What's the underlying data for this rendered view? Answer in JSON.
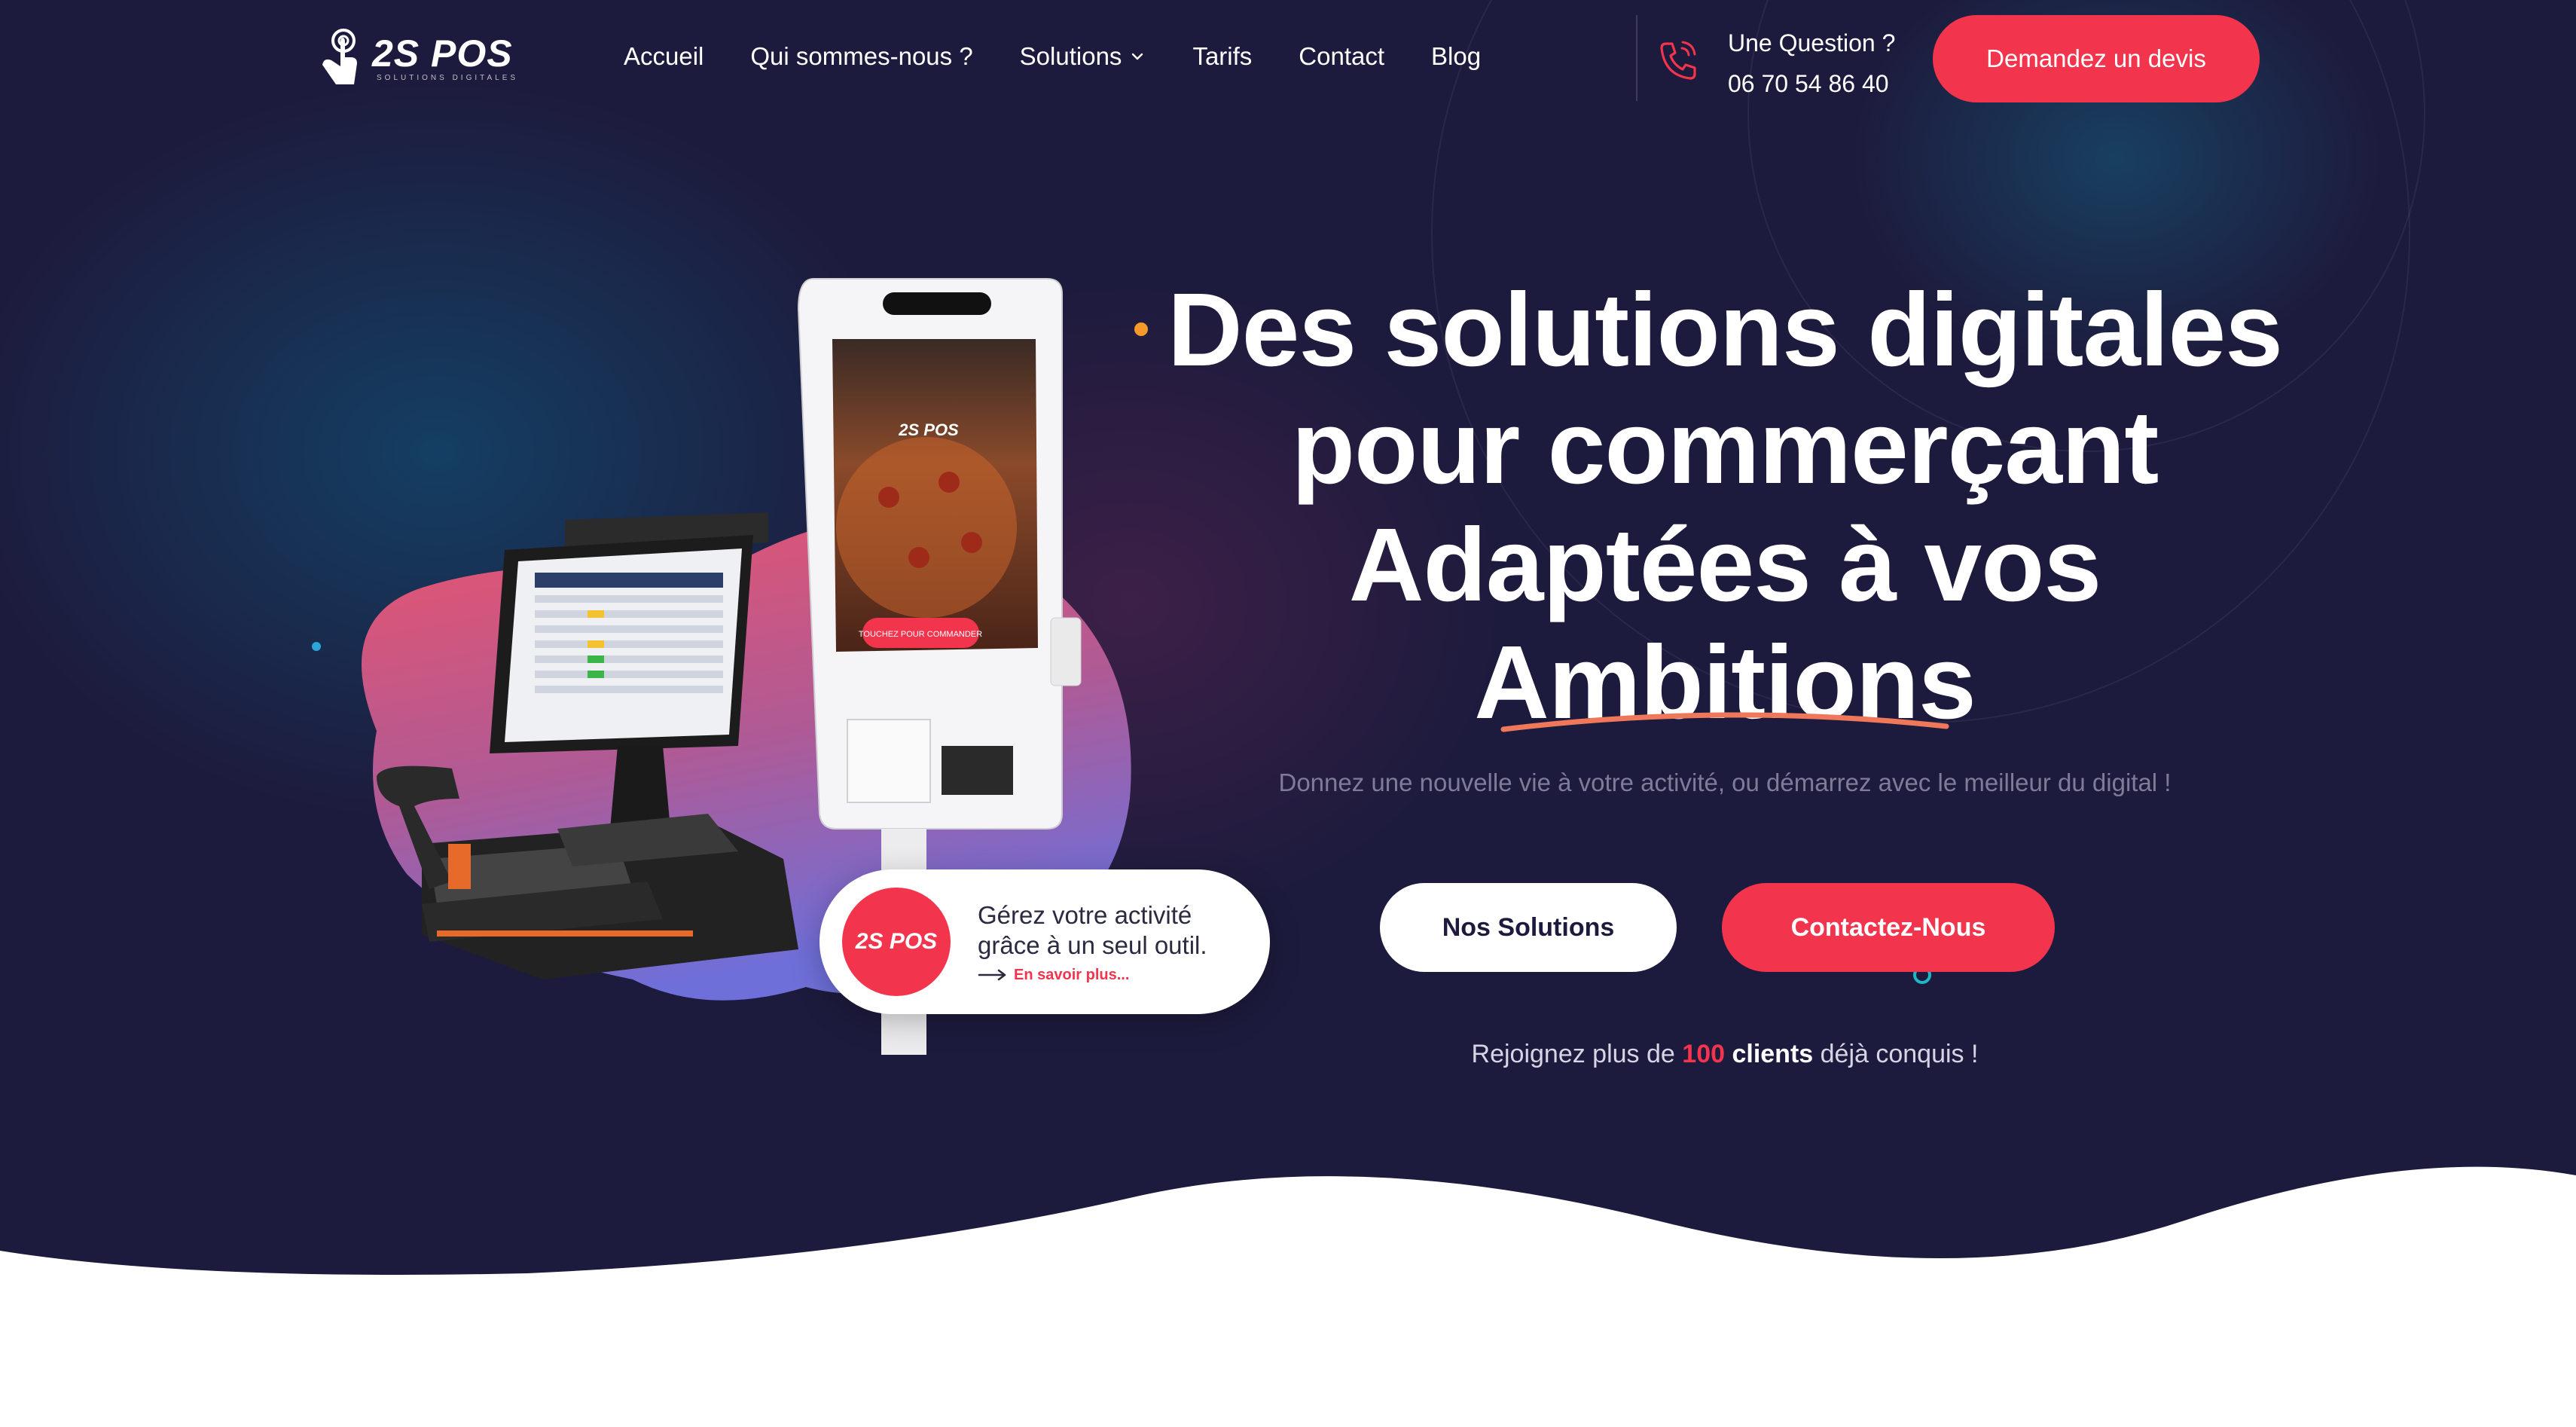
{
  "brand": {
    "name": "2S POS",
    "tagline": "SOLUTIONS DIGITALES",
    "accent_color": "#f2344d",
    "background_color": "#1d1b3d"
  },
  "nav": {
    "items": [
      {
        "label": "Accueil"
      },
      {
        "label": "Qui sommes-nous ?"
      },
      {
        "label": "Solutions",
        "has_dropdown": true
      },
      {
        "label": "Tarifs"
      },
      {
        "label": "Contact"
      },
      {
        "label": "Blog"
      }
    ]
  },
  "contact": {
    "question_label": "Une Question ?",
    "phone": "06 70 54 86 40",
    "icon": "phone-icon"
  },
  "header_cta": {
    "label": "Demandez un devis"
  },
  "hero": {
    "title_lines": [
      "Des solutions digitales",
      "pour commerçant",
      "Adaptées à vos",
      "Ambitions"
    ],
    "subtitle": "Donnez une nouvelle vie à votre activité, ou démarrez avec le meilleur du digital !",
    "primary_button": "Nos Solutions",
    "secondary_button": "Contactez-Nous",
    "social_proof": {
      "prefix": "Rejoignez plus de",
      "count": "100",
      "noun": "clients",
      "suffix": "déjà conquis !"
    }
  },
  "callout": {
    "badge": "2S POS",
    "line1": "Gérez votre activité",
    "line2": "grâce à un seul outil.",
    "link": "En savoir plus..."
  },
  "kiosk": {
    "brand": "2S POS",
    "button": "TOUCHEZ POUR COMMANDER"
  }
}
